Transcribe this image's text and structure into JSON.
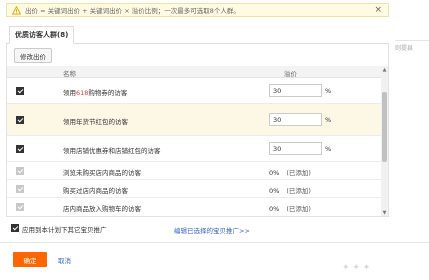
{
  "notice": {
    "text": "出价 = 关键词出价 + 关键词出价 × 溢价比例；一次最多可选取8个人群。",
    "close_glyph": "×"
  },
  "tabs": [
    {
      "label": "优质访客人群(8)"
    }
  ],
  "right_ghost_text": "则提县",
  "toolbar": {
    "edit_premium_label": "修改出价"
  },
  "table": {
    "headers": {
      "name": "名称",
      "premium": "溢价"
    },
    "rows": [
      {
        "label_pre": "领用",
        "label_hl": "618",
        "label_post": "购物券的访客",
        "checked": true,
        "disabled": false,
        "editable": true,
        "value": "30",
        "unit": "%"
      },
      {
        "label": "领用年货节红包的访客",
        "checked": true,
        "disabled": false,
        "editable": true,
        "value": "30",
        "unit": "%"
      },
      {
        "label": "领用店铺优惠券和店铺红包的访客",
        "checked": true,
        "disabled": false,
        "editable": true,
        "value": "30",
        "unit": "%"
      },
      {
        "label": "浏览未购买店内商品的访客",
        "checked": true,
        "disabled": true,
        "editable": false,
        "value": "0%",
        "status": "(已添加)"
      },
      {
        "label": "购买过店内商品的访客",
        "checked": true,
        "disabled": true,
        "editable": false,
        "value": "0%",
        "status": "(已添加)"
      },
      {
        "label": "店内商品放入购物车的访客",
        "checked": true,
        "disabled": true,
        "editable": false,
        "value": "0%",
        "status": "(已添加)"
      }
    ]
  },
  "footer": {
    "apply_all_label": "应用到本计划下其它宝贝推广",
    "edit_selected_link": "编辑已选择的宝贝推广>>",
    "ok_label": "确定",
    "cancel_label": "取消"
  },
  "colors": {
    "accent": "#ff6600",
    "link": "#3366cc",
    "highlight_row": "#fdf8e5",
    "notice_bg": "#fffbe2"
  },
  "icons": [
    "warning-icon",
    "close-icon",
    "checkbox-icon",
    "scroll-up-icon",
    "scroll-down-icon"
  ]
}
